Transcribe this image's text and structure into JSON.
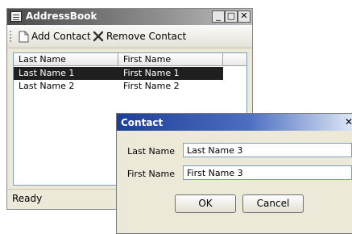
{
  "main_window": {
    "title": "AddressBook",
    "minimize_label": "_",
    "maximize_label": "□",
    "close_label": "✕"
  },
  "toolbar": {
    "add_label": "Add Contact",
    "remove_label": "Remove Contact"
  },
  "list": {
    "columns": [
      "Last Name",
      "First Name"
    ],
    "rows": [
      {
        "last": "Last Name 1",
        "first": "First Name 1",
        "selected": true
      },
      {
        "last": "Last Name 2",
        "first": "First Name 2",
        "selected": false
      }
    ]
  },
  "status": {
    "text": "Ready"
  },
  "dialog": {
    "title": "Contact",
    "close_label": "✕",
    "last_name_label": "Last Name",
    "last_name_value": "Last Name 3",
    "first_name_label": "First Name",
    "first_name_value": "First Name 3",
    "ok_label": "OK",
    "cancel_label": "Cancel"
  },
  "colors": {
    "selection": "#1f1f1f",
    "dialog_title": "#1c3e96",
    "window_face": "#ece9d8"
  }
}
